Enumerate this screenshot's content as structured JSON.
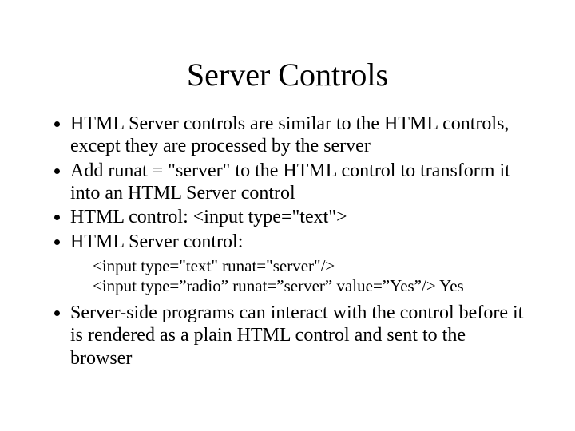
{
  "title": "Server Controls",
  "bullets": {
    "b1": "HTML Server controls are similar to the HTML controls, except they are processed by the server",
    "b2": "Add runat = \"server\" to the HTML control to transform it into an HTML Server control",
    "b3": "HTML control:  <input type=\"text\">",
    "b4": "HTML Server control:",
    "b5": "Server-side programs can interact with the control before it is rendered as a plain HTML control and sent to the browser"
  },
  "sub": {
    "s1": "<input type=\"text\" runat=\"server\"/>",
    "s2": "<input type=”radio” runat=”server” value=”Yes”/> Yes"
  }
}
